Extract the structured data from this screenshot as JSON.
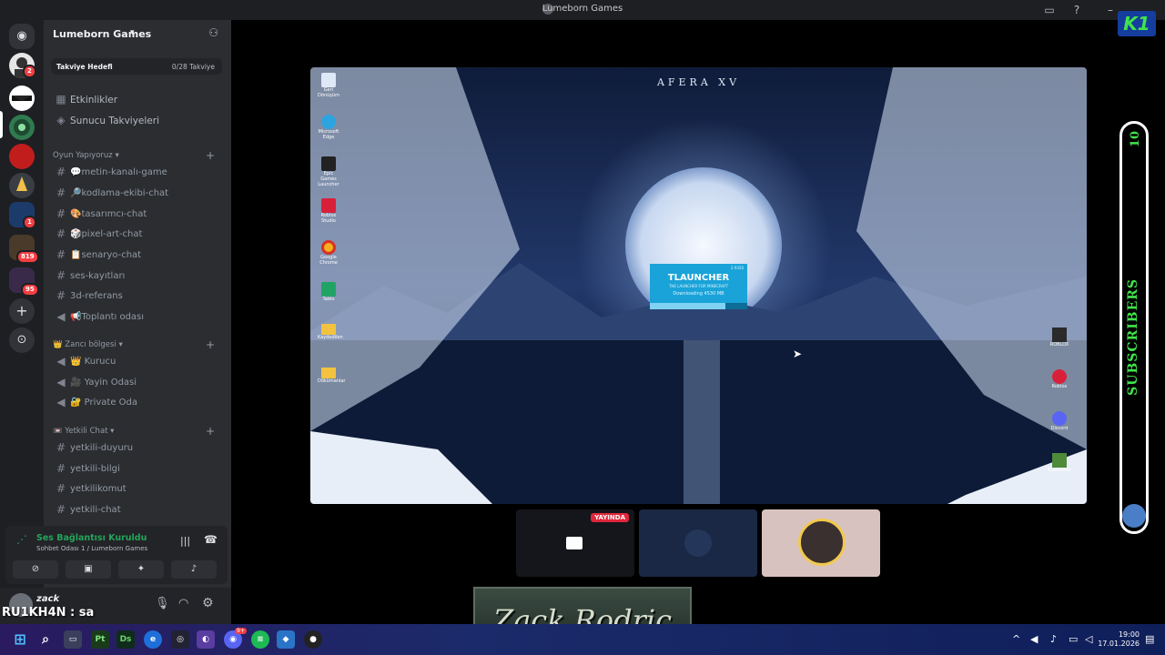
{
  "window": {
    "title": "Lumeborn Games"
  },
  "server": {
    "name": "Lumeborn Games",
    "boost_label": "Takviye Hedefi",
    "boost_count": "0/28 Takviye",
    "top_items": [
      {
        "label": "Etkinlikler"
      },
      {
        "label": "Sunucu Takviyeleri"
      }
    ],
    "categories": [
      {
        "name": "Oyun Yapıyoruz",
        "channels": [
          {
            "label": "💬metin-kanalı-game",
            "type": "text"
          },
          {
            "label": "🔎kodlama-ekibi-chat",
            "type": "text"
          },
          {
            "label": "🎨tasarımcı-chat",
            "type": "text"
          },
          {
            "label": "🎲pixel-art-chat",
            "type": "text"
          },
          {
            "label": "📋senaryo-chat",
            "type": "text"
          },
          {
            "label": "ses-kayıtları",
            "type": "text"
          },
          {
            "label": "3d-referans",
            "type": "text"
          },
          {
            "label": "📢Toplantı odası",
            "type": "voice"
          }
        ]
      },
      {
        "name": "👑 Zancı bölgesi",
        "channels": [
          {
            "label": "👑 Kurucu",
            "type": "voice"
          },
          {
            "label": "🎥 Yayin Odasi",
            "type": "voice"
          },
          {
            "label": "🔐 Private Oda",
            "type": "voice"
          }
        ]
      },
      {
        "name": "📼 Yetkili Chat",
        "channels": [
          {
            "label": "yetkili-duyuru",
            "type": "text"
          },
          {
            "label": "yetkili-bilgi",
            "type": "text"
          },
          {
            "label": "yetkilikomut",
            "type": "text"
          },
          {
            "label": "yetkili-chat",
            "type": "text"
          }
        ]
      }
    ]
  },
  "rail_badges": [
    "2",
    "1",
    "819",
    "95"
  ],
  "voice": {
    "status": "Ses Bağlantısı Kuruldu",
    "channel": "Sohbet Odası 1 / Lumeborn Games"
  },
  "user": {
    "name": "zack"
  },
  "chat_overlay": "RU1KH4N : sa",
  "stream": {
    "desktop_title": "AFERA XV",
    "launcher_title": "TLAUNCHER",
    "launcher_sub": "THE LAUNCHER FOR MINECRAFT",
    "launcher_status": "Downloading 4530 MB",
    "launcher_version": "2.9350",
    "live_badge": "YAYINDA",
    "desktop_icons": [
      "Geri Dönüşüm",
      "Microsoft Edge",
      "Epic Games Launcher",
      "Roblox Studio",
      "Google Chrome",
      "Tablo",
      "Kaydedilen",
      "Dökümanlar"
    ],
    "desktop_icons_right": [
      "ROBLOX",
      "Roblox",
      "Discord",
      "TLauncher"
    ]
  },
  "name_tag": "Zack Rodric",
  "subscribers": {
    "count": "10",
    "label": "SUBSCRIBERS"
  },
  "brand_badge": "K1",
  "taskbar": {
    "apps": [
      "Pt",
      "Ds"
    ],
    "discord_badge": "9+",
    "time": "19:00",
    "date": "17.01.2026"
  },
  "colors": {
    "accent_green": "#23a55a",
    "sidebar_bg": "#2b2d31",
    "rail_bg": "#1e1f22",
    "badge_red": "#f23f43"
  }
}
